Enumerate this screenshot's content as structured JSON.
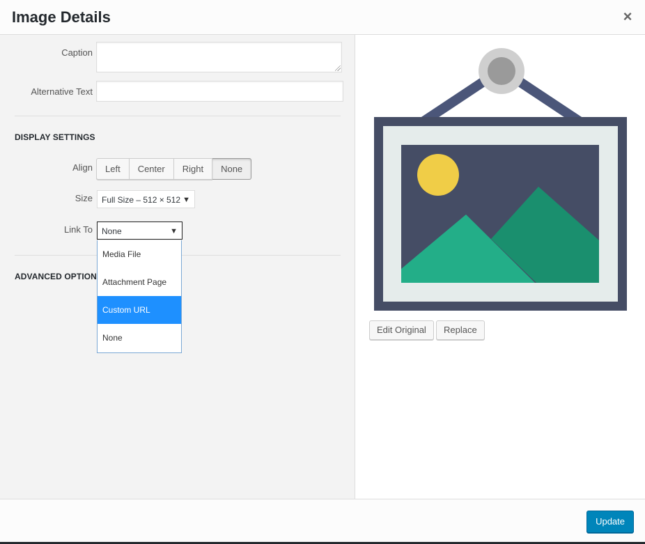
{
  "header": {
    "title": "Image Details",
    "close_glyph": "×"
  },
  "fields": {
    "caption_label": "Caption",
    "caption_value": "",
    "alt_label": "Alternative Text",
    "alt_value": ""
  },
  "display_settings": {
    "heading": "DISPLAY SETTINGS",
    "align_label": "Align",
    "align_options": [
      "Left",
      "Center",
      "Right",
      "None"
    ],
    "align_selected": "None",
    "size_label": "Size",
    "size_value": "Full Size – 512 × 512",
    "link_label": "Link To",
    "link_value": "None",
    "link_options": [
      "Media File",
      "Attachment Page",
      "Custom URL",
      "None"
    ],
    "link_highlighted": "Custom URL"
  },
  "advanced": {
    "heading": "ADVANCED OPTIONS"
  },
  "image_actions": {
    "edit_original": "Edit Original",
    "replace": "Replace"
  },
  "footer": {
    "update_label": "Update"
  },
  "icons": {
    "close": "close-icon",
    "dropdown_arrow": "triangle-down-icon",
    "preview": "image-placeholder-icon"
  },
  "colors": {
    "primary_button": "#0085ba",
    "highlight": "#1e90ff",
    "frame_dark": "#454d65",
    "mat": "#e5eceb",
    "sun": "#f0cd47",
    "mountain_light": "#23ae88",
    "mountain_dark": "#1a8f6e"
  }
}
